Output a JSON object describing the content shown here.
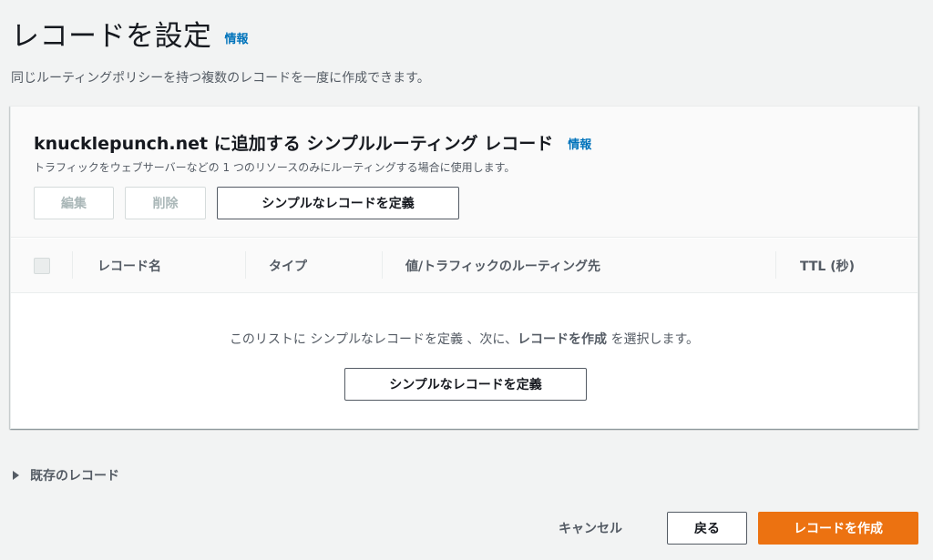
{
  "page": {
    "title": "レコードを設定",
    "info_label": "情報",
    "description": "同じルーティングポリシーを持つ複数のレコードを一度に作成できます。"
  },
  "panel": {
    "title": "knucklepunch.net に追加する シンプルルーティング レコード",
    "info_label": "情報",
    "description": "トラフィックをウェブサーバーなどの 1 つのリソースのみにルーティングする場合に使用します。",
    "buttons": {
      "edit": "編集",
      "delete": "削除",
      "define": "シンプルなレコードを定義"
    },
    "table": {
      "columns": [
        "レコード名",
        "タイプ",
        "値/トラフィックのルーティング先",
        "TTL (秒)"
      ]
    },
    "empty": {
      "prefix": "このリストに シンプルなレコードを定義 、次に、",
      "bold": "レコードを作成",
      "suffix": " を選択します。",
      "button": "シンプルなレコードを定義"
    }
  },
  "existing_records": {
    "label": "既存のレコード"
  },
  "footer": {
    "cancel": "キャンセル",
    "back": "戻る",
    "create": "レコードを作成"
  },
  "colors": {
    "primary": "#ec7211",
    "link": "#0073bb",
    "background": "#f2f3f3"
  }
}
